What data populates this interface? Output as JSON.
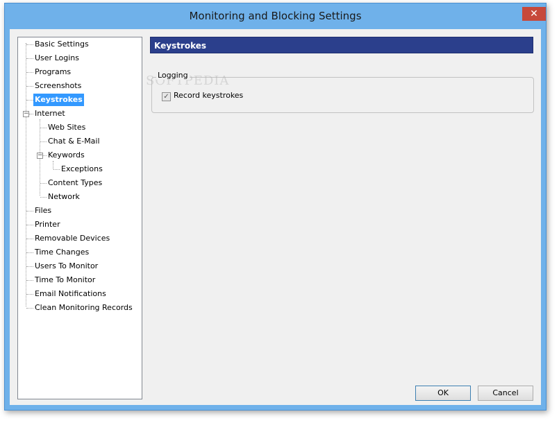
{
  "window": {
    "title": "Monitoring and Blocking Settings",
    "close_glyph": "✕"
  },
  "tree": {
    "items": [
      {
        "label": "Basic Settings"
      },
      {
        "label": "User Logins"
      },
      {
        "label": "Programs"
      },
      {
        "label": "Screenshots"
      },
      {
        "label": "Keystrokes",
        "selected": true
      },
      {
        "label": "Internet",
        "expanded": true
      },
      {
        "label": "Web Sites"
      },
      {
        "label": "Chat & E-Mail"
      },
      {
        "label": "Keywords",
        "expanded": true
      },
      {
        "label": "Exceptions"
      },
      {
        "label": "Content Types"
      },
      {
        "label": "Network"
      },
      {
        "label": "Files"
      },
      {
        "label": "Printer"
      },
      {
        "label": "Removable Devices"
      },
      {
        "label": "Time Changes"
      },
      {
        "label": "Users To Monitor"
      },
      {
        "label": "Time To Monitor"
      },
      {
        "label": "Email Notifications"
      },
      {
        "label": "Clean Monitoring Records"
      }
    ],
    "collapse_glyph": "−"
  },
  "panel": {
    "header": "Keystrokes",
    "group_label": "Logging",
    "watermark": "SOFTPEDIA",
    "record_keystrokes": {
      "label": "Record keystrokes",
      "checked": true,
      "check_glyph": "✓"
    }
  },
  "buttons": {
    "ok": "OK",
    "cancel": "Cancel"
  },
  "colors": {
    "header_bg": "#2b3f8c",
    "selection_bg": "#3399ff",
    "close_bg": "#c7493b",
    "frame": "#6fb1ea"
  }
}
